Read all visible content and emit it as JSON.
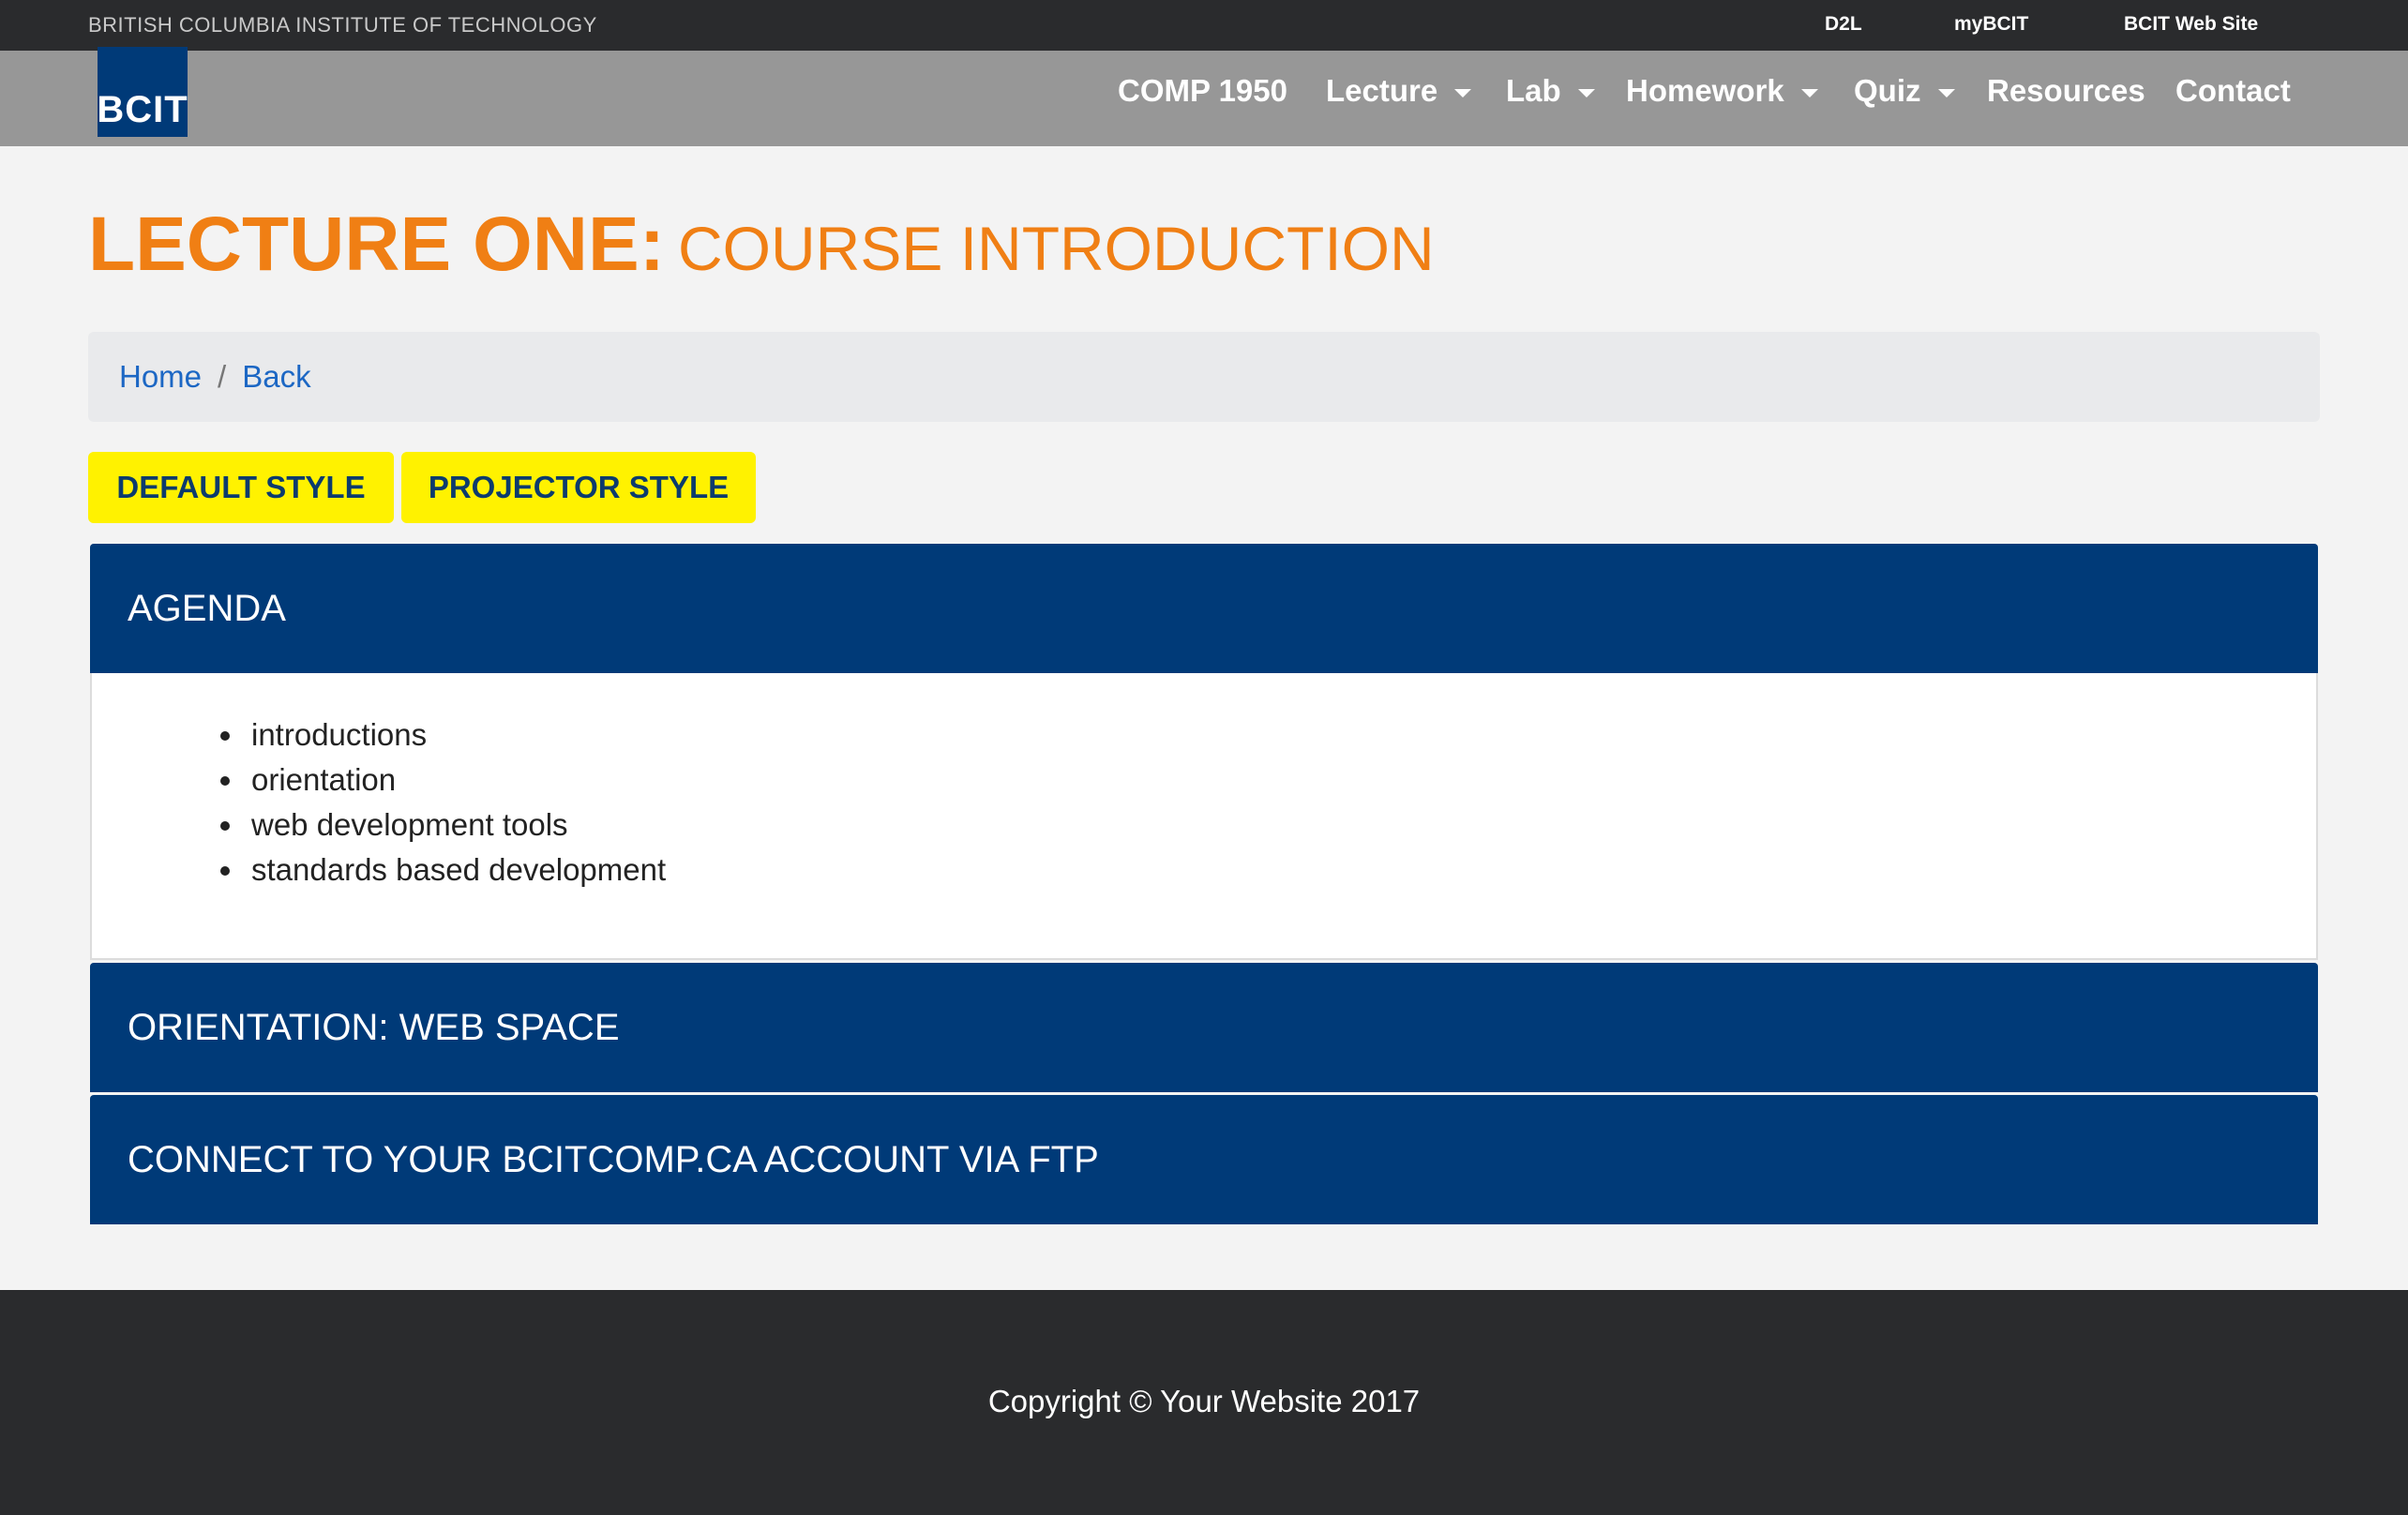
{
  "topbar": {
    "institution": "BRITISH COLUMBIA INSTITUTE OF TECHNOLOGY",
    "links": [
      "D2L",
      "myBCIT",
      "BCIT Web Site"
    ]
  },
  "navbar": {
    "logo_text": "BCIT",
    "items": [
      {
        "label": "COMP 1950",
        "dropdown": false
      },
      {
        "label": "Lecture",
        "dropdown": true
      },
      {
        "label": "Lab",
        "dropdown": true
      },
      {
        "label": "Homework",
        "dropdown": true
      },
      {
        "label": "Quiz",
        "dropdown": true
      },
      {
        "label": "Resources",
        "dropdown": false
      },
      {
        "label": "Contact",
        "dropdown": false
      }
    ]
  },
  "heading": {
    "bold": "LECTURE ONE:",
    "light": "COURSE INTRODUCTION"
  },
  "breadcrumb": {
    "home": "Home",
    "separator": "/",
    "back": "Back"
  },
  "style_buttons": {
    "default": "DEFAULT STYLE",
    "projector": "PROJECTOR STYLE"
  },
  "panels": [
    {
      "title": "AGENDA",
      "expanded": true,
      "items": [
        "introductions",
        "orientation",
        "web development tools",
        "standards based development"
      ]
    },
    {
      "title": "ORIENTATION: WEB SPACE",
      "expanded": false
    },
    {
      "title": "CONNECT TO YOUR BCITCOMP.CA ACCOUNT VIA FTP",
      "expanded": false
    }
  ],
  "footer": {
    "copyright": "Copyright © Your Website 2017"
  },
  "colors": {
    "topbar": "#2a2b2d",
    "navbar": "#979797",
    "brand_blue": "#003a78",
    "heading_orange": "#f07f14",
    "button_yellow": "#fff200",
    "link_blue": "#1c67c4"
  },
  "icons": {
    "dropdown": "caret-down-icon"
  }
}
